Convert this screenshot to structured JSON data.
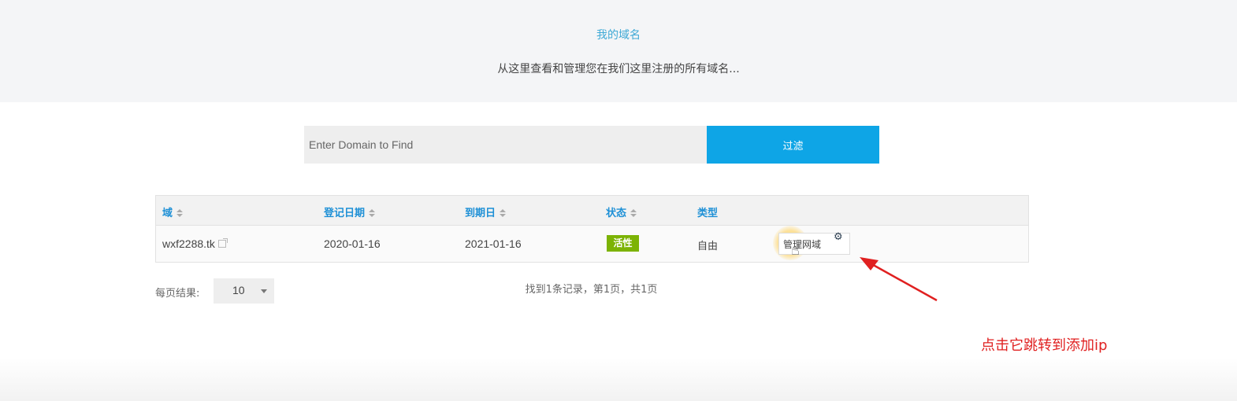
{
  "hero": {
    "title": "我的域名",
    "subtitle": "从这里查看和管理您在我们这里注册的所有域名..."
  },
  "search": {
    "placeholder": "Enter Domain to Find",
    "button_label": "过滤"
  },
  "table": {
    "columns": [
      "域",
      "登记日期",
      "到期日",
      "状态",
      "类型"
    ],
    "rows": [
      {
        "domain": "wxf2288.tk",
        "registered": "2020-01-16",
        "expires": "2021-01-16",
        "status": "活性",
        "type": "自由",
        "action_label": "管理网域"
      }
    ]
  },
  "pagination": {
    "per_page_label": "每页结果:",
    "per_page_value": "10",
    "records_text": "找到1条记录，第1页，共1页"
  },
  "annotation": {
    "text": "点击它跳转到添加ip",
    "color": "#e02020"
  },
  "colors": {
    "accent": "#0ea5e6",
    "header_link": "#1e90d6",
    "status_active": "#7cb305"
  },
  "icons": [
    "sort-icon",
    "external-link-icon",
    "gear-icon",
    "hand-cursor-icon",
    "chevron-down-icon",
    "arrow-icon"
  ]
}
